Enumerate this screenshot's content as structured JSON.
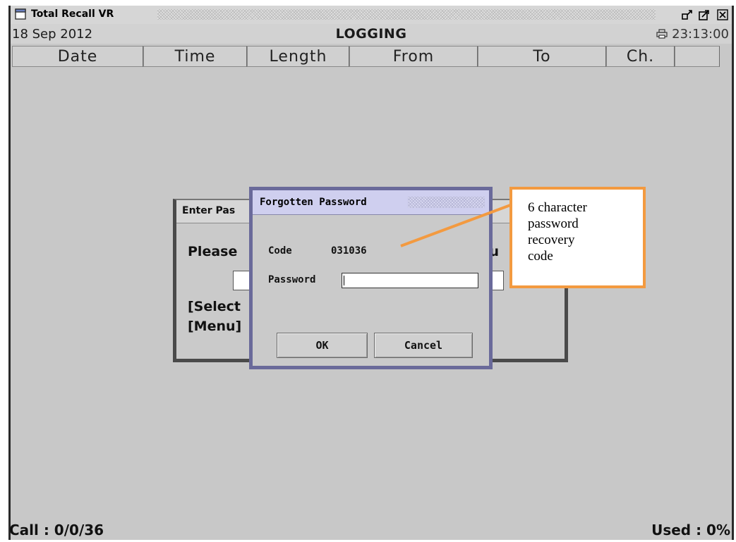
{
  "window": {
    "title": "Total Recall VR"
  },
  "status": {
    "date": "18 Sep 2012",
    "mode": "LOGGING",
    "time": "23:13:00"
  },
  "columns": [
    "Date",
    "Time",
    "Length",
    "From",
    "To",
    "Ch.",
    ""
  ],
  "footer": {
    "call": "Call : 0/0/36",
    "used": "Used : 0%"
  },
  "background_dialog": {
    "title": "Enter Pas",
    "prompt": "Please",
    "prompt_right": "nu",
    "select_hint": "[Select",
    "menu_hint": "[Menu]"
  },
  "forgotten_dialog": {
    "title": "Forgotten Password",
    "code_label": "Code",
    "code_value": "031036",
    "password_label": "Password",
    "password_value": "",
    "ok_label": "OK",
    "cancel_label": "Cancel"
  },
  "callout": {
    "lines": [
      "6 character",
      "password",
      "recovery",
      "code"
    ],
    "border_color": "#f39a40"
  },
  "colors": {
    "dialog_title_bg": "#cfcfef",
    "dialog_border": "#6a6a9a",
    "app_bg": "#c8c8c8"
  }
}
